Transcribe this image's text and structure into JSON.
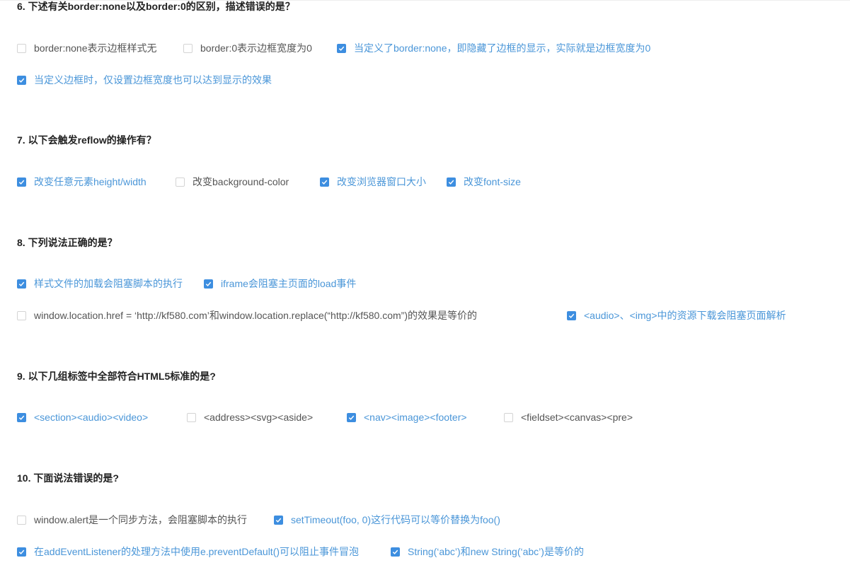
{
  "accent_color": "#3d8ee0",
  "selected_text_color": "#4a96d8",
  "questions": [
    {
      "title": "6. 下述有关border:none以及border:0的区别，描述错误的是？",
      "options": [
        {
          "label": "border:none表示边框样式无",
          "checked": false
        },
        {
          "label": "border:0表示边框宽度为0",
          "checked": false
        },
        {
          "label": "当定义了border:none，即隐藏了边框的显示，实际就是边框宽度为0",
          "checked": true
        },
        {
          "label": "当定义边框时，仅设置边框宽度也可以达到显示的效果",
          "checked": true
        }
      ]
    },
    {
      "title": "7. 以下会触发reflow的操作有？",
      "options": [
        {
          "label": "改变任意元素height/width",
          "checked": true
        },
        {
          "label": "改变background-color",
          "checked": false
        },
        {
          "label": "改变浏览器窗口大小",
          "checked": true
        },
        {
          "label": "改变font-size",
          "checked": true
        }
      ]
    },
    {
      "title": "8. 下列说法正确的是？",
      "options": [
        {
          "label": "样式文件的加载会阻塞脚本的执行",
          "checked": true
        },
        {
          "label": "iframe会阻塞主页面的load事件",
          "checked": true
        },
        {
          "label": "window.location.href = ‘http://kf580.com’和window.location.replace(“http://kf580.com”)的效果是等价的",
          "checked": false
        },
        {
          "label": "<audio>、<img>中的资源下载会阻塞页面解析",
          "checked": true
        }
      ]
    },
    {
      "title": "9. 以下几组标签中全部符合HTML5标准的是?",
      "options": [
        {
          "label": "<section><audio><video>",
          "checked": true
        },
        {
          "label": "<address><svg><aside>",
          "checked": false
        },
        {
          "label": "<nav><image><footer>",
          "checked": true
        },
        {
          "label": "<fieldset><canvas><pre>",
          "checked": false
        }
      ]
    },
    {
      "title": "10. 下面说法错误的是?",
      "options": [
        {
          "label": "window.alert是一个同步方法，会阻塞脚本的执行",
          "checked": false
        },
        {
          "label": "setTimeout(foo, 0)这行代码可以等价替换为foo()",
          "checked": true
        },
        {
          "label": "在addEventListener的处理方法中使用e.preventDefault()可以阻止事件冒泡",
          "checked": true
        },
        {
          "label": "String(‘abc’)和new String(‘abc’)是等价的",
          "checked": true
        }
      ]
    }
  ]
}
